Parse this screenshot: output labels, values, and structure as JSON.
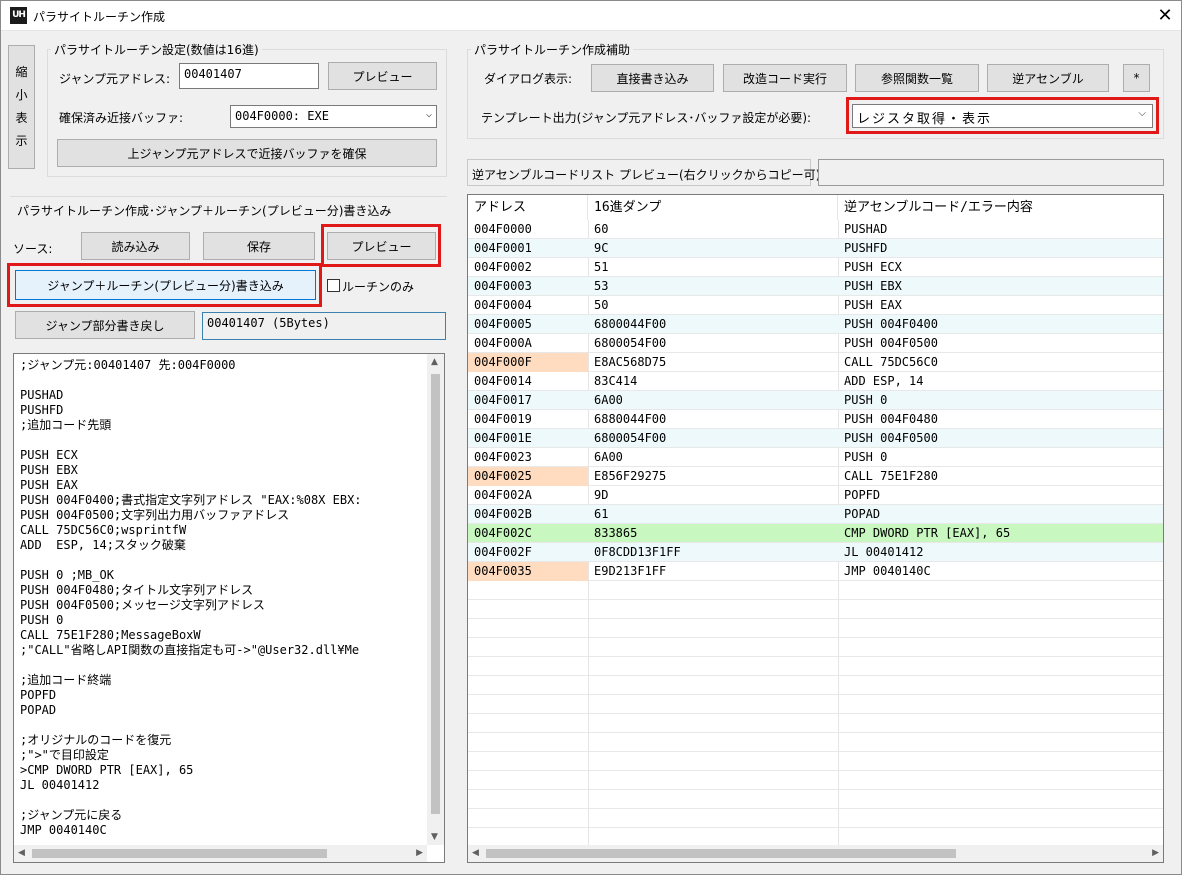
{
  "window": {
    "icon_text": "UH",
    "title": "パラサイトルーチン作成",
    "close_glyph": "✕"
  },
  "side_button": {
    "label_chars": [
      "縮",
      "小",
      "表",
      "示"
    ]
  },
  "settings_group": {
    "title": "パラサイトルーチン設定(数値は16進)",
    "jump_src_label": "ジャンプ元アドレス:",
    "jump_src_value": "00401407",
    "preview_button": "プレビュー",
    "buffer_label": "確保済み近接バッファ:",
    "buffer_value": "004F0000: EXE",
    "secure_button": "上ジャンプ元アドレスで近接バッファを確保"
  },
  "helper_group": {
    "title": "パラサイトルーチン作成補助",
    "dialog_label": "ダイアログ表示:",
    "buttons": [
      "直接書き込み",
      "改造コード実行",
      "参照関数一覧",
      "逆アセンブル",
      "*"
    ],
    "template_label": "テンプレート出力(ジャンプ元アドレス･バッファ設定が必要):",
    "template_value": "レジスタ取得・表示"
  },
  "create_section": {
    "header": "パラサイトルーチン作成･ジャンプ＋ルーチン(プレビュー分)書き込み",
    "source_label": "ソース:",
    "load_button": "読み込み",
    "save_button": "保存",
    "preview_button": "プレビュー",
    "write_button": "ジャンプ＋ルーチン(プレビュー分)書き込み",
    "routine_only_label": "ルーチンのみ",
    "revert_button": "ジャンプ部分書き戻し",
    "revert_info": "00401407 (5Bytes)"
  },
  "source_code": ";ジャンプ元:00401407 先:004F0000\n\nPUSHAD\nPUSHFD\n;追加コード先頭\n\nPUSH ECX\nPUSH EBX\nPUSH EAX\nPUSH 004F0400;書式指定文字列アドレス \"EAX:%08X EBX:\nPUSH 004F0500;文字列出力用バッファアドレス\nCALL 75DC56C0;wsprintfW\nADD  ESP, 14;スタック破棄\n\nPUSH 0 ;MB_OK\nPUSH 004F0480;タイトル文字列アドレス\nPUSH 004F0500;メッセージ文字列アドレス\nPUSH 0\nCALL 75E1F280;MessageBoxW\n;\"CALL\"省略しAPI関数の直接指定も可->\"@User32.dll¥Me\n\n;追加コード終端\nPOPFD\nPOPAD\n\n;オリジナルのコードを復元\n;\">\"で目印設定\n>CMP DWORD PTR [EAX], 65\nJL 00401412\n\n;ジャンプ元に戻る\nJMP 0040140C",
  "disasm": {
    "header": "逆アセンブルコードリスト プレビュー(右クリックからコピー可)",
    "columns": [
      "アドレス",
      "16進ダンプ",
      "逆アセンブルコード/エラー内容"
    ],
    "rows": [
      {
        "addr": "004F0000",
        "hex": "60",
        "asm": "PUSHAD",
        "style": ""
      },
      {
        "addr": "004F0001",
        "hex": "9C",
        "asm": "PUSHFD",
        "style": "alt"
      },
      {
        "addr": "004F0002",
        "hex": "51",
        "asm": "PUSH ECX",
        "style": ""
      },
      {
        "addr": "004F0003",
        "hex": "53",
        "asm": "PUSH EBX",
        "style": "alt"
      },
      {
        "addr": "004F0004",
        "hex": "50",
        "asm": "PUSH EAX",
        "style": ""
      },
      {
        "addr": "004F0005",
        "hex": "6800044F00",
        "asm": "PUSH 004F0400",
        "style": "alt"
      },
      {
        "addr": "004F000A",
        "hex": "6800054F00",
        "asm": "PUSH 004F0500",
        "style": ""
      },
      {
        "addr": "004F000F",
        "hex": "E8AC568D75",
        "asm": "CALL 75DC56C0",
        "style": "call"
      },
      {
        "addr": "004F0014",
        "hex": "83C414",
        "asm": "ADD  ESP, 14",
        "style": ""
      },
      {
        "addr": "004F0017",
        "hex": "6A00",
        "asm": "PUSH 0",
        "style": "alt"
      },
      {
        "addr": "004F0019",
        "hex": "6880044F00",
        "asm": "PUSH 004F0480",
        "style": ""
      },
      {
        "addr": "004F001E",
        "hex": "6800054F00",
        "asm": "PUSH 004F0500",
        "style": "alt"
      },
      {
        "addr": "004F0023",
        "hex": "6A00",
        "asm": "PUSH 0",
        "style": ""
      },
      {
        "addr": "004F0025",
        "hex": "E856F29275",
        "asm": "CALL 75E1F280",
        "style": "call"
      },
      {
        "addr": "004F002A",
        "hex": "9D",
        "asm": "POPFD",
        "style": ""
      },
      {
        "addr": "004F002B",
        "hex": "61",
        "asm": "POPAD",
        "style": "alt"
      },
      {
        "addr": "004F002C",
        "hex": "833865",
        "asm": "CMP DWORD PTR [EAX], 65",
        "style": "hl"
      },
      {
        "addr": "004F002F",
        "hex": "0F8CDD13F1FF",
        "asm": "JL 00401412",
        "style": "alt"
      },
      {
        "addr": "004F0035",
        "hex": "E9D213F1FF",
        "asm": "JMP 0040140C",
        "style": "call"
      }
    ]
  },
  "colors": {
    "highlight_red": "#e01818",
    "row_alt": "#eef9fb",
    "row_green": "#c8f7c0",
    "row_call": "#ffdcc0"
  }
}
